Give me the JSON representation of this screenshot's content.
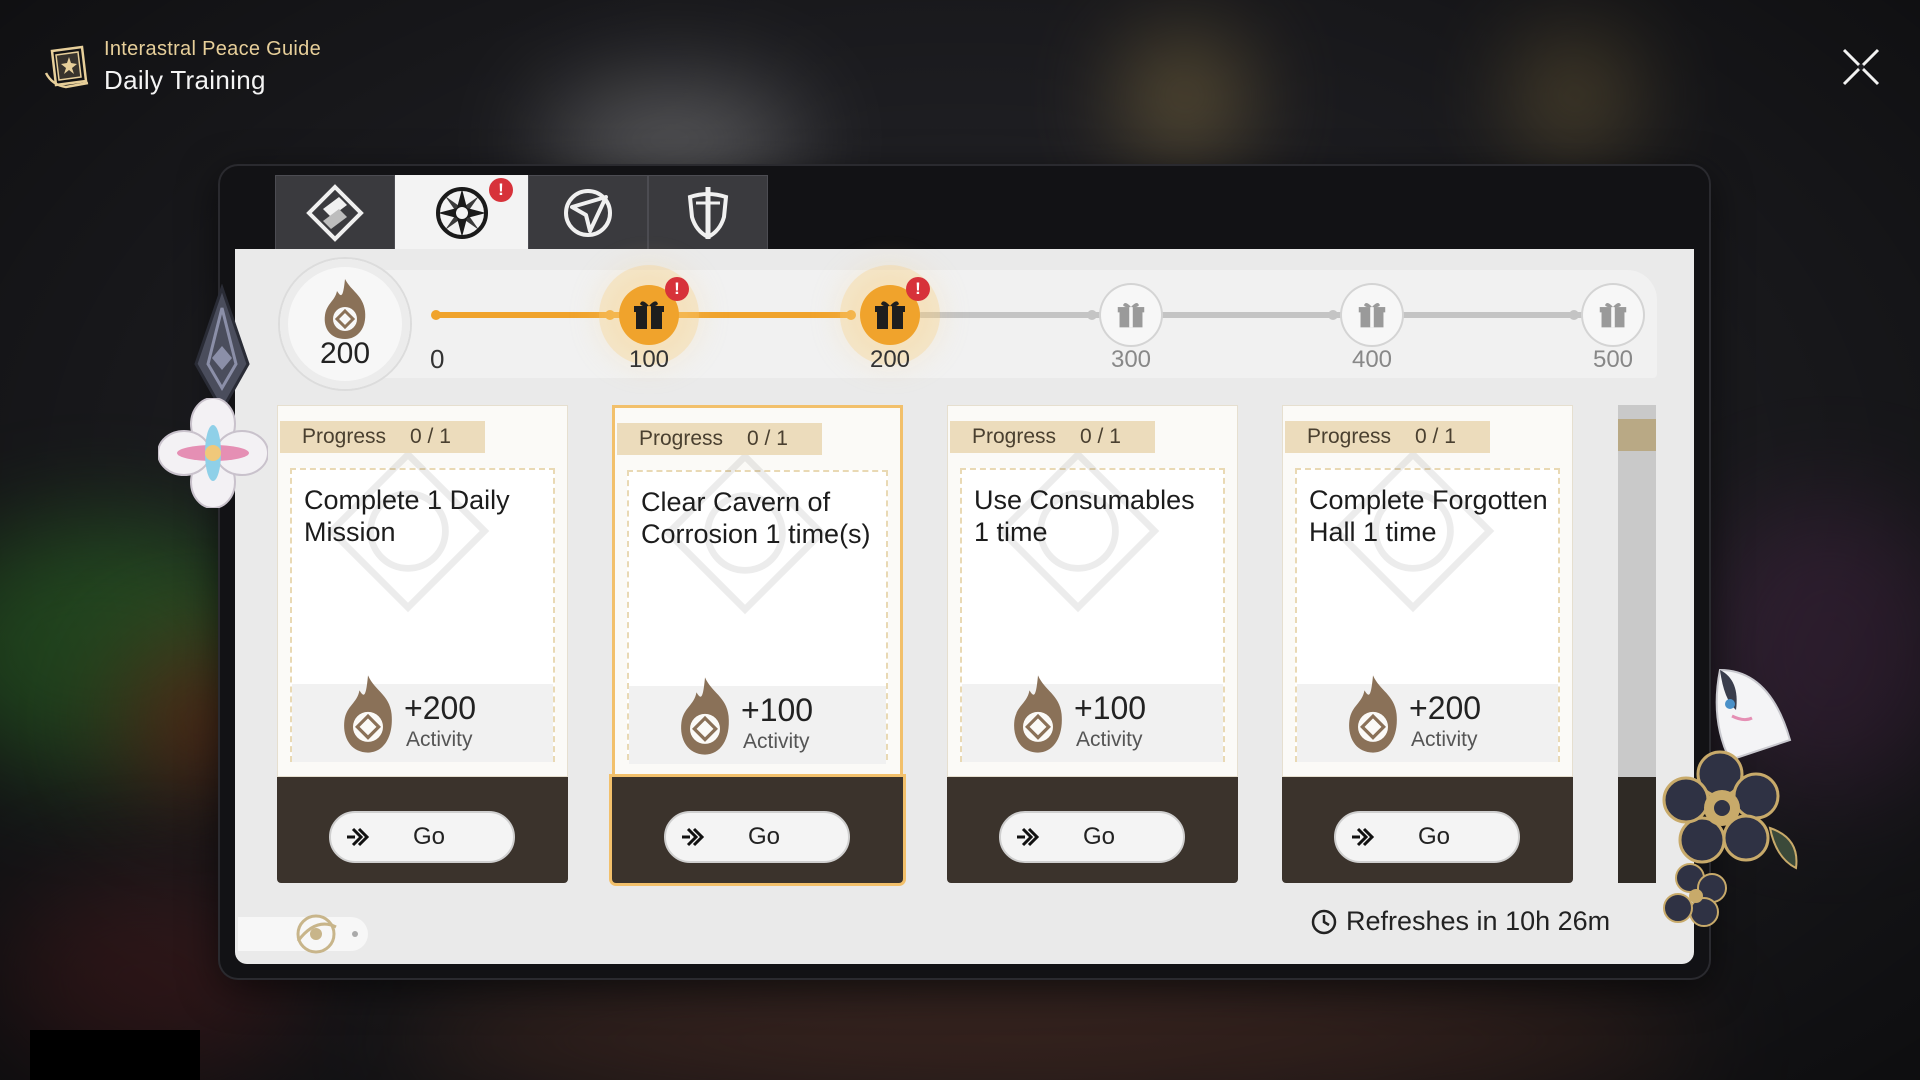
{
  "header": {
    "subtitle": "Interastral Peace Guide",
    "title": "Daily Training"
  },
  "tabs": [
    {
      "name": "tab-1",
      "active": false,
      "badge": false
    },
    {
      "name": "tab-2",
      "active": true,
      "badge": true,
      "badge_text": "!"
    },
    {
      "name": "tab-3",
      "active": false,
      "badge": false
    },
    {
      "name": "tab-4",
      "active": false,
      "badge": false
    }
  ],
  "activity": {
    "current": "200",
    "start_label": "0",
    "milestones": [
      {
        "value": "100",
        "state": "claimable",
        "badge": "!"
      },
      {
        "value": "200",
        "state": "claimable",
        "badge": "!"
      },
      {
        "value": "300",
        "state": "locked"
      },
      {
        "value": "400",
        "state": "locked"
      },
      {
        "value": "500",
        "state": "locked"
      }
    ]
  },
  "cards": [
    {
      "progress_label": "Progress",
      "progress_value": "0 / 1",
      "title": "Complete 1 Daily Mission",
      "reward_value": "+200",
      "reward_label": "Activity",
      "go_label": "Go",
      "selected": false
    },
    {
      "progress_label": "Progress",
      "progress_value": "0 / 1",
      "title": "Clear Cavern of Corrosion 1 time(s)",
      "reward_value": "+100",
      "reward_label": "Activity",
      "go_label": "Go",
      "selected": true
    },
    {
      "progress_label": "Progress",
      "progress_value": "0 / 1",
      "title": "Use Consumables 1 time",
      "reward_value": "+100",
      "reward_label": "Activity",
      "go_label": "Go",
      "selected": false
    },
    {
      "progress_label": "Progress",
      "progress_value": "0 / 1",
      "title": "Complete Forgotten Hall 1 time",
      "reward_value": "+200",
      "reward_label": "Activity",
      "go_label": "Go",
      "selected": false
    }
  ],
  "refresh": {
    "label": "Refreshes in",
    "time": "10h 26m"
  },
  "colors": {
    "accent_gold": "#f0a32c",
    "badge_red": "#d7323a",
    "tag_beige": "#ecdcbc",
    "card_footer": "#3b332c"
  }
}
